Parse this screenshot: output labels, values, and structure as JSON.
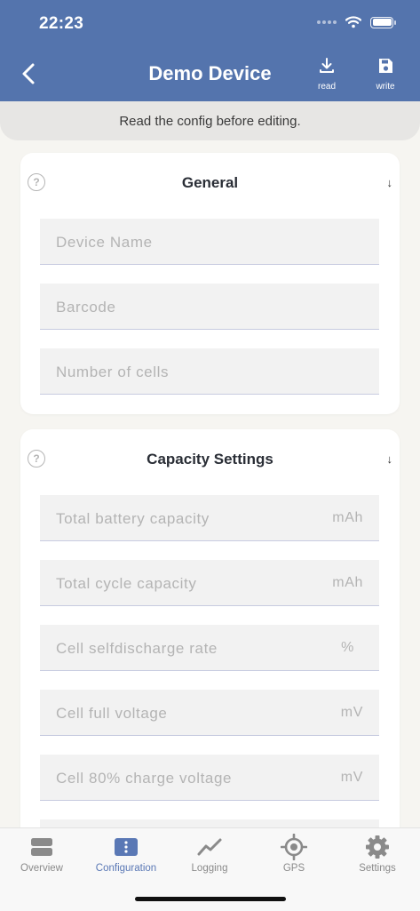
{
  "status_bar": {
    "time": "22:23"
  },
  "header": {
    "title": "Demo Device",
    "read_label": "read",
    "write_label": "write"
  },
  "banner": {
    "text": "Read the config before editing."
  },
  "sections": {
    "general": {
      "title": "General",
      "fields": [
        {
          "placeholder": "Device Name"
        },
        {
          "placeholder": "Barcode"
        },
        {
          "placeholder": "Number of cells"
        }
      ]
    },
    "capacity": {
      "title": "Capacity Settings",
      "fields": [
        {
          "placeholder": "Total battery capacity",
          "unit": "mAh"
        },
        {
          "placeholder": "Total cycle capacity",
          "unit": "mAh"
        },
        {
          "placeholder": "Cell selfdischarge rate",
          "unit": "%"
        },
        {
          "placeholder": "Cell full voltage",
          "unit": "mV"
        },
        {
          "placeholder": "Cell 80% charge voltage",
          "unit": "mV"
        }
      ]
    }
  },
  "tabs": [
    {
      "label": "Overview",
      "icon": "overview-icon"
    },
    {
      "label": "Configuration",
      "icon": "configuration-icon",
      "active": true
    },
    {
      "label": "Logging",
      "icon": "logging-chart-icon"
    },
    {
      "label": "GPS",
      "icon": "gps-target-icon"
    },
    {
      "label": "Settings",
      "icon": "gear-icon"
    }
  ],
  "colors": {
    "header_bg": "#5474ad",
    "active_tab": "#5a78b5",
    "inactive_tab": "#8a8a8a",
    "page_bg": "#f6f5f1"
  }
}
